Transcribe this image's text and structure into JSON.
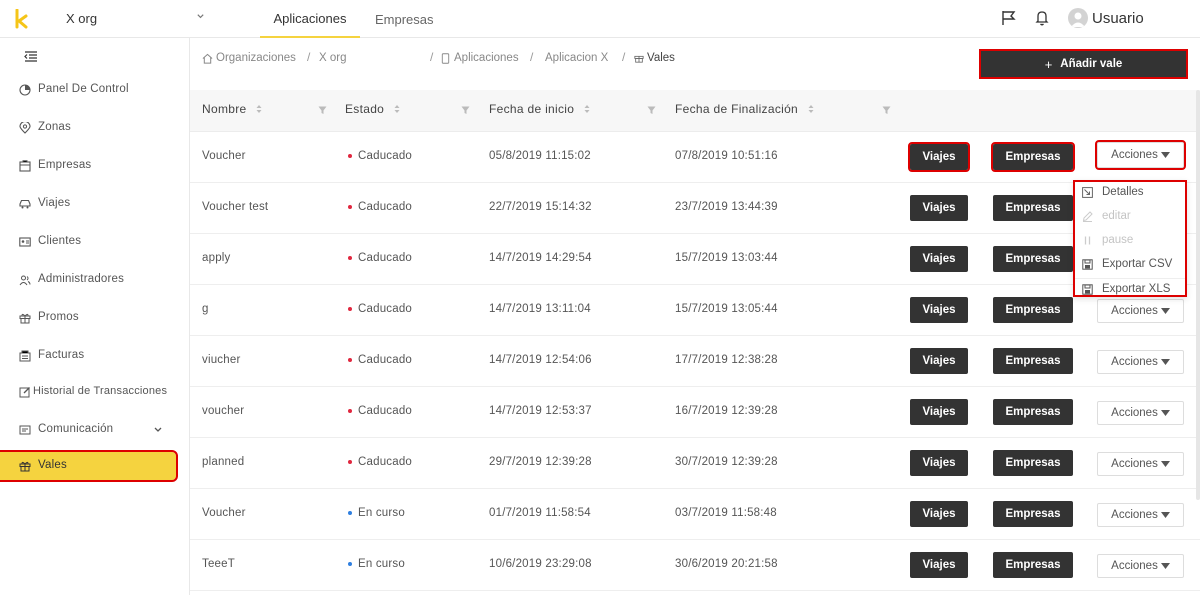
{
  "topbar": {
    "org_name": "X org",
    "tabs": [
      {
        "label": "Aplicaciones",
        "active": true
      },
      {
        "label": "Empresas",
        "active": false
      }
    ],
    "user_label": "Usuario",
    "icons": [
      "flag-icon",
      "bell-icon",
      "user-avatar-icon"
    ],
    "accent_color": "#f5d33f"
  },
  "sidebar": {
    "items": [
      {
        "label": "Panel De Control",
        "icon": "dashboard-icon"
      },
      {
        "label": "Zonas",
        "icon": "location-pin-icon"
      },
      {
        "label": "Empresas",
        "icon": "building-icon"
      },
      {
        "label": "Viajes",
        "icon": "car-icon"
      },
      {
        "label": "Clientes",
        "icon": "id-card-icon"
      },
      {
        "label": "Administradores",
        "icon": "users-icon"
      },
      {
        "label": "Promos",
        "icon": "gift-icon"
      },
      {
        "label": "Facturas",
        "icon": "invoice-icon"
      },
      {
        "label": "Historial de Transacciones",
        "icon": "edit-icon"
      },
      {
        "label": "Comunicación",
        "icon": "communication-icon"
      },
      {
        "label": "Vales",
        "icon": "gift-icon",
        "active": true
      }
    ]
  },
  "breadcrumb": {
    "items": [
      "Organizaciones",
      "X org",
      "Aplicaciones",
      "Aplicacion X",
      "Vales"
    ]
  },
  "actions": {
    "add_label": "Añadir vale"
  },
  "table": {
    "columns": [
      "Nombre",
      "Estado",
      "Fecha de inicio",
      "Fecha de Finalización"
    ],
    "button_viajes": "Viajes",
    "button_empresas": "Empresas",
    "button_acciones": "Acciones",
    "rows": [
      {
        "name": "Voucher",
        "status": "Caducado",
        "status_color": "#e0273f",
        "start": "05/8/2019 11:15:02",
        "end": "07/8/2019 10:51:16"
      },
      {
        "name": "Voucher test",
        "status": "Caducado",
        "status_color": "#e0273f",
        "start": "22/7/2019 15:14:32",
        "end": "23/7/2019 13:44:39"
      },
      {
        "name": "apply",
        "status": "Caducado",
        "status_color": "#e0273f",
        "start": "14/7/2019 14:29:54",
        "end": "15/7/2019 13:03:44"
      },
      {
        "name": "g",
        "status": "Caducado",
        "status_color": "#e0273f",
        "start": "14/7/2019 13:11:04",
        "end": "15/7/2019 13:05:44"
      },
      {
        "name": "viucher",
        "status": "Caducado",
        "status_color": "#e0273f",
        "start": "14/7/2019 12:54:06",
        "end": "17/7/2019 12:38:28"
      },
      {
        "name": "voucher",
        "status": "Caducado",
        "status_color": "#e0273f",
        "start": "14/7/2019 12:53:37",
        "end": "16/7/2019 12:39:28"
      },
      {
        "name": "planned",
        "status": "Caducado",
        "status_color": "#e0273f",
        "start": "29/7/2019 12:39:28",
        "end": "30/7/2019 12:39:28"
      },
      {
        "name": "Voucher",
        "status": "En curso",
        "status_color": "#2f7fe0",
        "start": "01/7/2019 11:58:54",
        "end": "03/7/2019 11:58:48"
      },
      {
        "name": "TeeeT",
        "status": "En curso",
        "status_color": "#2f7fe0",
        "start": "10/6/2019 23:29:08",
        "end": "30/6/2019 20:21:58"
      }
    ]
  },
  "dropdown": {
    "items": [
      {
        "label": "Detalles",
        "icon": "details-icon",
        "disabled": false
      },
      {
        "label": "editar",
        "icon": "pencil-icon",
        "disabled": true
      },
      {
        "label": "pause",
        "icon": "pause-icon",
        "disabled": true
      },
      {
        "label": "Exportar CSV",
        "icon": "save-icon",
        "disabled": false
      },
      {
        "label": "Exportar XLS",
        "icon": "save-icon",
        "disabled": false
      }
    ]
  }
}
